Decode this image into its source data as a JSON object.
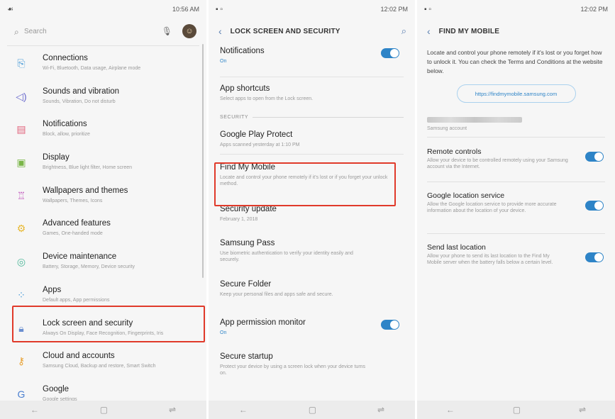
{
  "screen1": {
    "status": {
      "time": "10:56 AM"
    },
    "search": {
      "placeholder": "Search"
    },
    "items": [
      {
        "title": "Connections",
        "sub": "Wi-Fi, Bluetooth, Data usage, Airplane mode"
      },
      {
        "title": "Sounds and vibration",
        "sub": "Sounds, Vibration, Do not disturb"
      },
      {
        "title": "Notifications",
        "sub": "Block, allow, prioritize"
      },
      {
        "title": "Display",
        "sub": "Brightness, Blue light filter, Home screen"
      },
      {
        "title": "Wallpapers and themes",
        "sub": "Wallpapers, Themes, Icons"
      },
      {
        "title": "Advanced features",
        "sub": "Games, One-handed mode"
      },
      {
        "title": "Device maintenance",
        "sub": "Battery, Storage, Memory, Device security"
      },
      {
        "title": "Apps",
        "sub": "Default apps, App permissions"
      },
      {
        "title": "Lock screen and security",
        "sub": "Always On Display, Face Recognition, Fingerprints, Iris"
      },
      {
        "title": "Cloud and accounts",
        "sub": "Samsung Cloud, Backup and restore, Smart Switch"
      },
      {
        "title": "Google",
        "sub": "Google settings"
      }
    ]
  },
  "screen2": {
    "status": {
      "time": "12:02 PM"
    },
    "header": {
      "title": "LOCK SCREEN AND SECURITY"
    },
    "notifications": {
      "title": "Notifications",
      "sub": "On"
    },
    "app_shortcuts": {
      "title": "App shortcuts",
      "sub": "Select apps to open from the Lock screen."
    },
    "section": "SECURITY",
    "items": [
      {
        "title": "Google Play Protect",
        "sub": "Apps scanned yesterday at 1:10 PM"
      },
      {
        "title": "Find My Mobile",
        "sub": "Locate and control your phone remotely if it's lost or if you forget your unlock method."
      },
      {
        "title": "Security update",
        "sub": "February 1, 2018"
      },
      {
        "title": "Samsung Pass",
        "sub": "Use biometric authentication to verify your identity easily and securely."
      },
      {
        "title": "Secure Folder",
        "sub": "Keep your personal files and apps safe and secure."
      },
      {
        "title": "App permission monitor",
        "sub": "On"
      },
      {
        "title": "Secure startup",
        "sub": "Protect your device by using a screen lock when your device turns on."
      }
    ]
  },
  "screen3": {
    "status": {
      "time": "12:02 PM"
    },
    "header": {
      "title": "FIND MY MOBILE"
    },
    "intro": "Locate and control your phone remotely if it's lost or you forget how to unlock it. You can check the Terms and Conditions at the website below.",
    "link": "https://findmymobile.samsung.com",
    "account_label": "Samsung account",
    "items": [
      {
        "title": "Remote controls",
        "sub": "Allow your device to be controlled remotely using your Samsung account via the Internet."
      },
      {
        "title": "Google location service",
        "sub": "Allow the Google location service to provide more accurate information about the location of your device."
      },
      {
        "title": "Send last location",
        "sub": "Allow your phone to send its last location to the Find My Mobile server when the battery falls below a certain level."
      }
    ]
  },
  "colors": {
    "accent": "#2e84c7",
    "highlight": "#e03a2a"
  }
}
